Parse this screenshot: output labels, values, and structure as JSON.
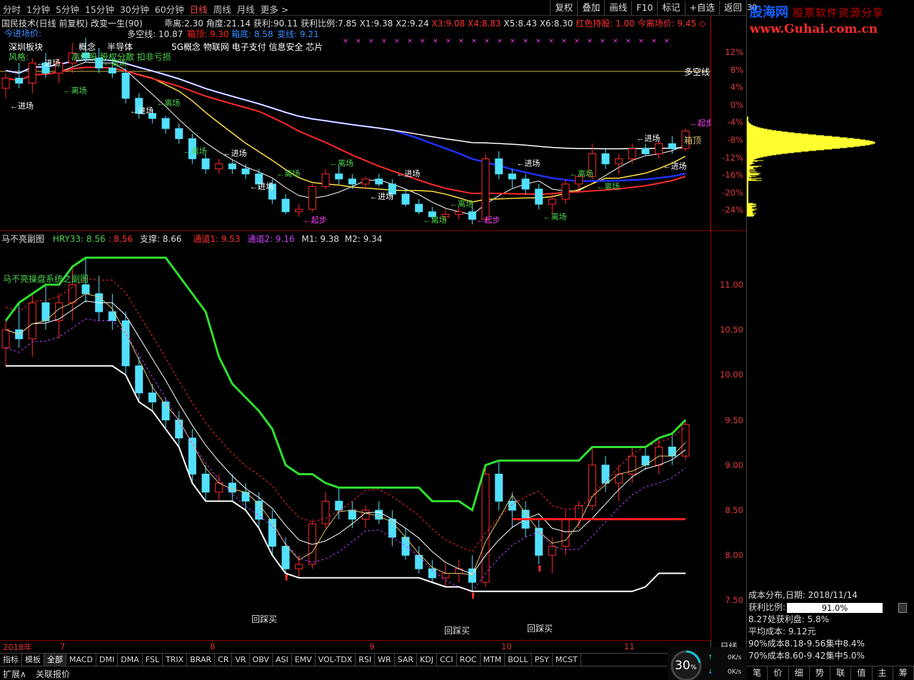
{
  "toolbar": {
    "periods": [
      "分时",
      "1分钟",
      "5分钟",
      "15分钟",
      "30分钟",
      "60分钟",
      "日线",
      "周线",
      "月线",
      "更多 >"
    ],
    "active_period": "日线",
    "right_buttons": [
      "复权",
      "叠加",
      "画线",
      "F10",
      "标记",
      "+自选",
      "返回"
    ],
    "page_no": "30"
  },
  "logo": {
    "cn": "股海网",
    "tagline": "股票软件资源分享",
    "url": "www.Guhai.com.cn"
  },
  "upper": {
    "title": "国民技术(日线 前复权) 改变一生(90)",
    "stats": [
      {
        "label": "乖离:",
        "value": "2.30",
        "color": "#dddddd"
      },
      {
        "label": "角度:",
        "value": "21.14",
        "color": "#dddddd"
      },
      {
        "label": "获利:",
        "value": "90.11",
        "color": "#dddddd"
      },
      {
        "label": "获利比例:",
        "value": "7.85",
        "color": "#dddddd"
      },
      {
        "label": "X1:",
        "value": "9.38",
        "color": "#dddddd"
      },
      {
        "label": "X2:",
        "value": "9.24",
        "color": "#dddddd"
      },
      {
        "label": "X3:",
        "value": "9.08",
        "color": "#ff3030"
      },
      {
        "label": "X4:",
        "value": "8.83",
        "color": "#ff3030"
      },
      {
        "label": "X5:",
        "value": "8.43",
        "color": "#dddddd"
      },
      {
        "label": "X6:",
        "value": "8.30",
        "color": "#dddddd"
      }
    ],
    "hold_text": "红色持股: 1.00",
    "today_entry": "今离场价: 9.45 ◇",
    "entry_price_label": "今进场价:",
    "duokong": "多空线: 10.87",
    "xiangding": "箱顶: 9.30",
    "xiangdi": "箱底: 8.58",
    "biandi": "变线: 9.21",
    "sector": "深圳板块",
    "concept": "概念",
    "semis": "半导体",
    "style": "风格:",
    "style_values": "高价股 股权分散 扣非亏损",
    "concepts_line": "5G概念 物联网 电子支付 信息安全 芯片",
    "duokong_label": "多空线",
    "xiangding_label": "箱顶",
    "percent_ticks": [
      "12%",
      "8%",
      "4%",
      "0%",
      "-4%",
      "-8%",
      "-12%",
      "-16%",
      "-20%",
      "-24%"
    ],
    "annotations": [
      "进场",
      "进场",
      "离场",
      "离场",
      "进场",
      "离场",
      "离场",
      "进场",
      "进场",
      "离场",
      "起步",
      "离场",
      "进场",
      "进场",
      "离场",
      "离场",
      "起步",
      "进场",
      "离场",
      "离场",
      "离场",
      "进场",
      "进场",
      "起步"
    ]
  },
  "lower": {
    "title": "马不亮副图",
    "hry": "HRY33: 8.56",
    "hry2": ": 8.56",
    "support": "支撑: 8.66",
    "ch1": "通道1: 9.53",
    "ch2": "通道2: 9.16",
    "m1": "M1: 9.38",
    "m2": "M2: 9.34",
    "system_text": "马不亮操盘系统之副图",
    "price_ticks": [
      "11.00",
      "10.50",
      "10.00",
      "9.50",
      "9.00",
      "8.50",
      "8.00",
      "7.50"
    ],
    "buy_labels": [
      "回踩买",
      "回踩买",
      "回踩买"
    ]
  },
  "datebar": {
    "labels": [
      "2018年",
      "7",
      "8",
      "9",
      "10",
      "11"
    ],
    "daytype": "日线"
  },
  "tabs": [
    "指标",
    "模板",
    "全部",
    "MACD",
    "DMI",
    "DMA",
    "FSL",
    "TRIX",
    "BRAR",
    "CR",
    "VR",
    "OBV",
    "ASI",
    "EMV",
    "VOL-TDX",
    "RSI",
    "WR",
    "SAR",
    "KDJ",
    "CCI",
    "ROC",
    "MTM",
    "BOLL",
    "PSY",
    "MCST"
  ],
  "active_tab": "全部",
  "status": {
    "expand": "扩展∧",
    "related": "关联报价"
  },
  "gauge": {
    "percent": "30",
    "unit": "%",
    "up": "0K/s",
    "down": "0K/s"
  },
  "cost": {
    "title": "成本分布,日期: 2018/11/14",
    "ratio_label": "获利比例:",
    "ratio_value": "91.0%",
    "ratio_fraction": 0.91,
    "profit_line": "8.27处获利盘: 5.8%",
    "avg_cost": "平均成本: 9.12元",
    "c90": "90%成本8.18-9.56集中8.4%",
    "c70": "70%成本8.60-9.42集中5.0%"
  },
  "right_tabs": [
    "笔",
    "价",
    "细",
    "势",
    "联",
    "值",
    "主",
    "筹"
  ],
  "chart_data": {
    "type": "candlestick",
    "symbol": "国民技术",
    "period": "日线",
    "x_months": [
      "2018年",
      "7",
      "8",
      "9",
      "10",
      "11"
    ],
    "ylim": [
      7.5,
      11.2
    ],
    "ohlc": [
      [
        10.3,
        10.6,
        10.1,
        10.5
      ],
      [
        10.5,
        10.8,
        10.3,
        10.4
      ],
      [
        10.4,
        10.9,
        10.2,
        10.8
      ],
      [
        10.8,
        11.0,
        10.5,
        10.6
      ],
      [
        10.6,
        10.9,
        10.4,
        10.8
      ],
      [
        10.8,
        11.2,
        10.6,
        11.0
      ],
      [
        11.0,
        11.3,
        10.8,
        10.9
      ],
      [
        10.9,
        11.1,
        10.6,
        10.7
      ],
      [
        10.7,
        10.9,
        10.5,
        10.6
      ],
      [
        10.6,
        10.7,
        10.0,
        10.1
      ],
      [
        10.1,
        10.2,
        9.7,
        9.8
      ],
      [
        9.8,
        9.9,
        9.6,
        9.7
      ],
      [
        9.7,
        9.75,
        9.4,
        9.5
      ],
      [
        9.5,
        9.6,
        9.2,
        9.3
      ],
      [
        9.3,
        9.4,
        8.8,
        8.9
      ],
      [
        8.9,
        9.0,
        8.6,
        8.7
      ],
      [
        8.7,
        8.9,
        8.6,
        8.8
      ],
      [
        8.8,
        8.9,
        8.6,
        8.7
      ],
      [
        8.7,
        8.8,
        8.5,
        8.6
      ],
      [
        8.6,
        8.7,
        8.3,
        8.4
      ],
      [
        8.4,
        8.5,
        8.0,
        8.1
      ],
      [
        8.1,
        8.2,
        7.8,
        7.85
      ],
      [
        7.85,
        8.0,
        7.75,
        7.9
      ],
      [
        7.9,
        8.4,
        7.85,
        8.35
      ],
      [
        8.35,
        8.7,
        8.3,
        8.6
      ],
      [
        8.6,
        8.75,
        8.4,
        8.5
      ],
      [
        8.5,
        8.6,
        8.3,
        8.4
      ],
      [
        8.4,
        8.55,
        8.3,
        8.5
      ],
      [
        8.5,
        8.6,
        8.35,
        8.4
      ],
      [
        8.4,
        8.5,
        8.1,
        8.2
      ],
      [
        8.2,
        8.3,
        7.95,
        8.0
      ],
      [
        8.0,
        8.1,
        7.8,
        7.85
      ],
      [
        7.85,
        7.95,
        7.7,
        7.75
      ],
      [
        7.75,
        7.9,
        7.65,
        7.8
      ],
      [
        7.8,
        7.95,
        7.7,
        7.85
      ],
      [
        7.85,
        8.0,
        7.6,
        7.7
      ],
      [
        7.7,
        9.0,
        7.65,
        8.9
      ],
      [
        8.9,
        9.05,
        8.5,
        8.6
      ],
      [
        8.6,
        8.7,
        8.3,
        8.5
      ],
      [
        8.5,
        8.6,
        8.2,
        8.3
      ],
      [
        8.3,
        8.4,
        7.9,
        8.0
      ],
      [
        8.0,
        8.2,
        7.8,
        8.1
      ],
      [
        8.1,
        8.5,
        8.0,
        8.4
      ],
      [
        8.4,
        8.6,
        8.3,
        8.55
      ],
      [
        8.55,
        9.2,
        8.5,
        9.0
      ],
      [
        9.0,
        9.1,
        8.7,
        8.8
      ],
      [
        8.8,
        9.0,
        8.6,
        8.9
      ],
      [
        8.9,
        9.2,
        8.8,
        9.1
      ],
      [
        9.1,
        9.2,
        8.95,
        9.0
      ],
      [
        9.0,
        9.3,
        8.9,
        9.2
      ],
      [
        9.2,
        9.35,
        9.0,
        9.1
      ],
      [
        9.1,
        9.5,
        9.05,
        9.45
      ]
    ]
  }
}
